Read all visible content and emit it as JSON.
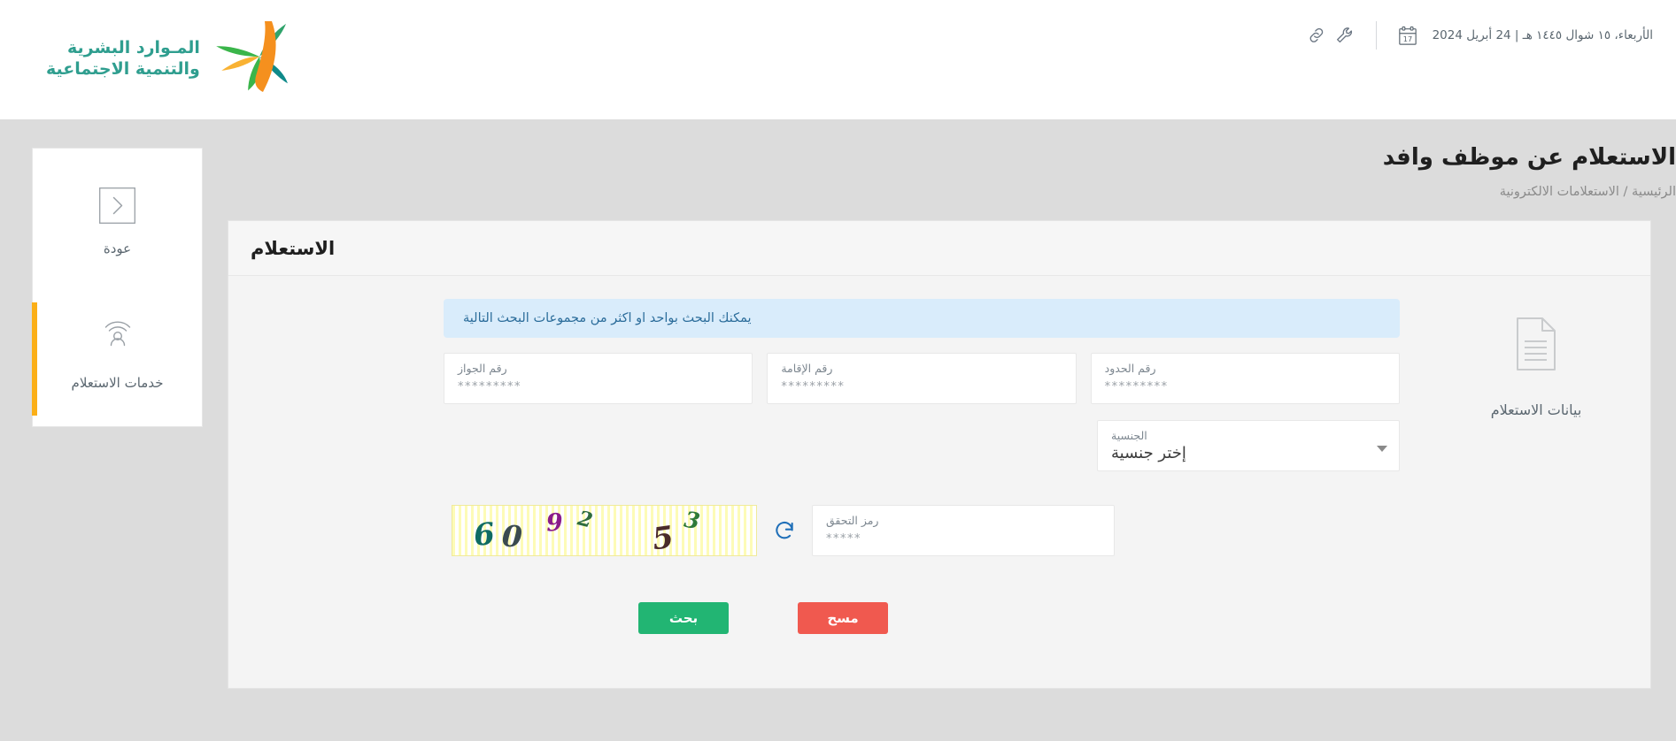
{
  "topbar": {
    "date_text": "الأربعاء، ١٥ شوال ١٤٤٥ هـ | 24 أبريل 2024",
    "calendar_day": "17",
    "calendar_icon": "calendar-icon",
    "wrench_icon": "wrench-icon",
    "link_icon": "link-icon",
    "logo_line1": "المـوارد البشرية",
    "logo_line2": "والتنمية الاجتماعية",
    "logo_color": "#2f9e8f"
  },
  "header": {
    "title": "الاستعلام عن موظف وافد",
    "breadcrumb": "الرئيسية / الاستعلامات الالكترونية"
  },
  "sidenav": {
    "items": [
      {
        "label": "عودة",
        "icon": "chevron-right-boxed-icon",
        "active": false
      },
      {
        "label": "خدمات الاستعلام",
        "icon": "user-radar-icon",
        "active": true
      }
    ],
    "active_color": "#fbaf17"
  },
  "card": {
    "title": "الاستعلام",
    "section": {
      "icon": "document-icon",
      "label": "بيانات الاستعلام"
    },
    "info_banner": {
      "text": "يمكنك البحث بواحد او اكثر من مجموعات البحث التالية",
      "bg": "#d9ecfb",
      "fg": "#2c6d9b"
    },
    "fields": [
      {
        "label": "رقم الحدود",
        "value": "",
        "placeholder": "*********"
      },
      {
        "label": "رقم الإقامة",
        "value": "",
        "placeholder": "*********"
      },
      {
        "label": "رقم الجواز",
        "value": "",
        "placeholder": "*********"
      }
    ],
    "nationality": {
      "label": "الجنسية",
      "value": "إختر جنسية",
      "caret_icon": "chevron-down-icon"
    },
    "captcha": {
      "field_label": "رمز التحقق",
      "field_value": "",
      "field_placeholder": "*****",
      "refresh_icon": "refresh-icon",
      "code_characters": [
        {
          "char": "6",
          "color": "#0f6b63"
        },
        {
          "char": "0",
          "color": "#3a4a4f"
        },
        {
          "char": "9",
          "color": "#8a1b8a"
        },
        {
          "char": "2",
          "color": "#2e6b3e"
        },
        {
          "char": "5",
          "color": "#4a2b2b"
        },
        {
          "char": "3",
          "color": "#2f7a3a"
        }
      ],
      "code_text": "609253"
    },
    "buttons": {
      "search": {
        "label": "بحث",
        "color": "#22b573"
      },
      "clear": {
        "label": "مسح",
        "color": "#f0594f"
      }
    }
  }
}
